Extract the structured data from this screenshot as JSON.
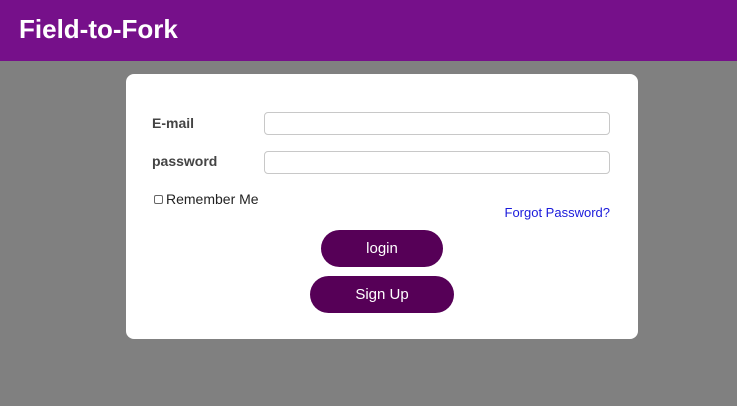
{
  "header": {
    "title": "Field-to-Fork",
    "color": "#76108a"
  },
  "form": {
    "email_label": "E-mail",
    "email_value": "",
    "password_label": "password",
    "password_value": "",
    "remember_label": "Remember Me",
    "remember_checked": false,
    "forgot_label": "Forgot Password?",
    "login_label": "login",
    "signup_label": "Sign Up",
    "button_color": "#560057",
    "link_color": "#1a1adb"
  },
  "page": {
    "background": "#808080"
  }
}
